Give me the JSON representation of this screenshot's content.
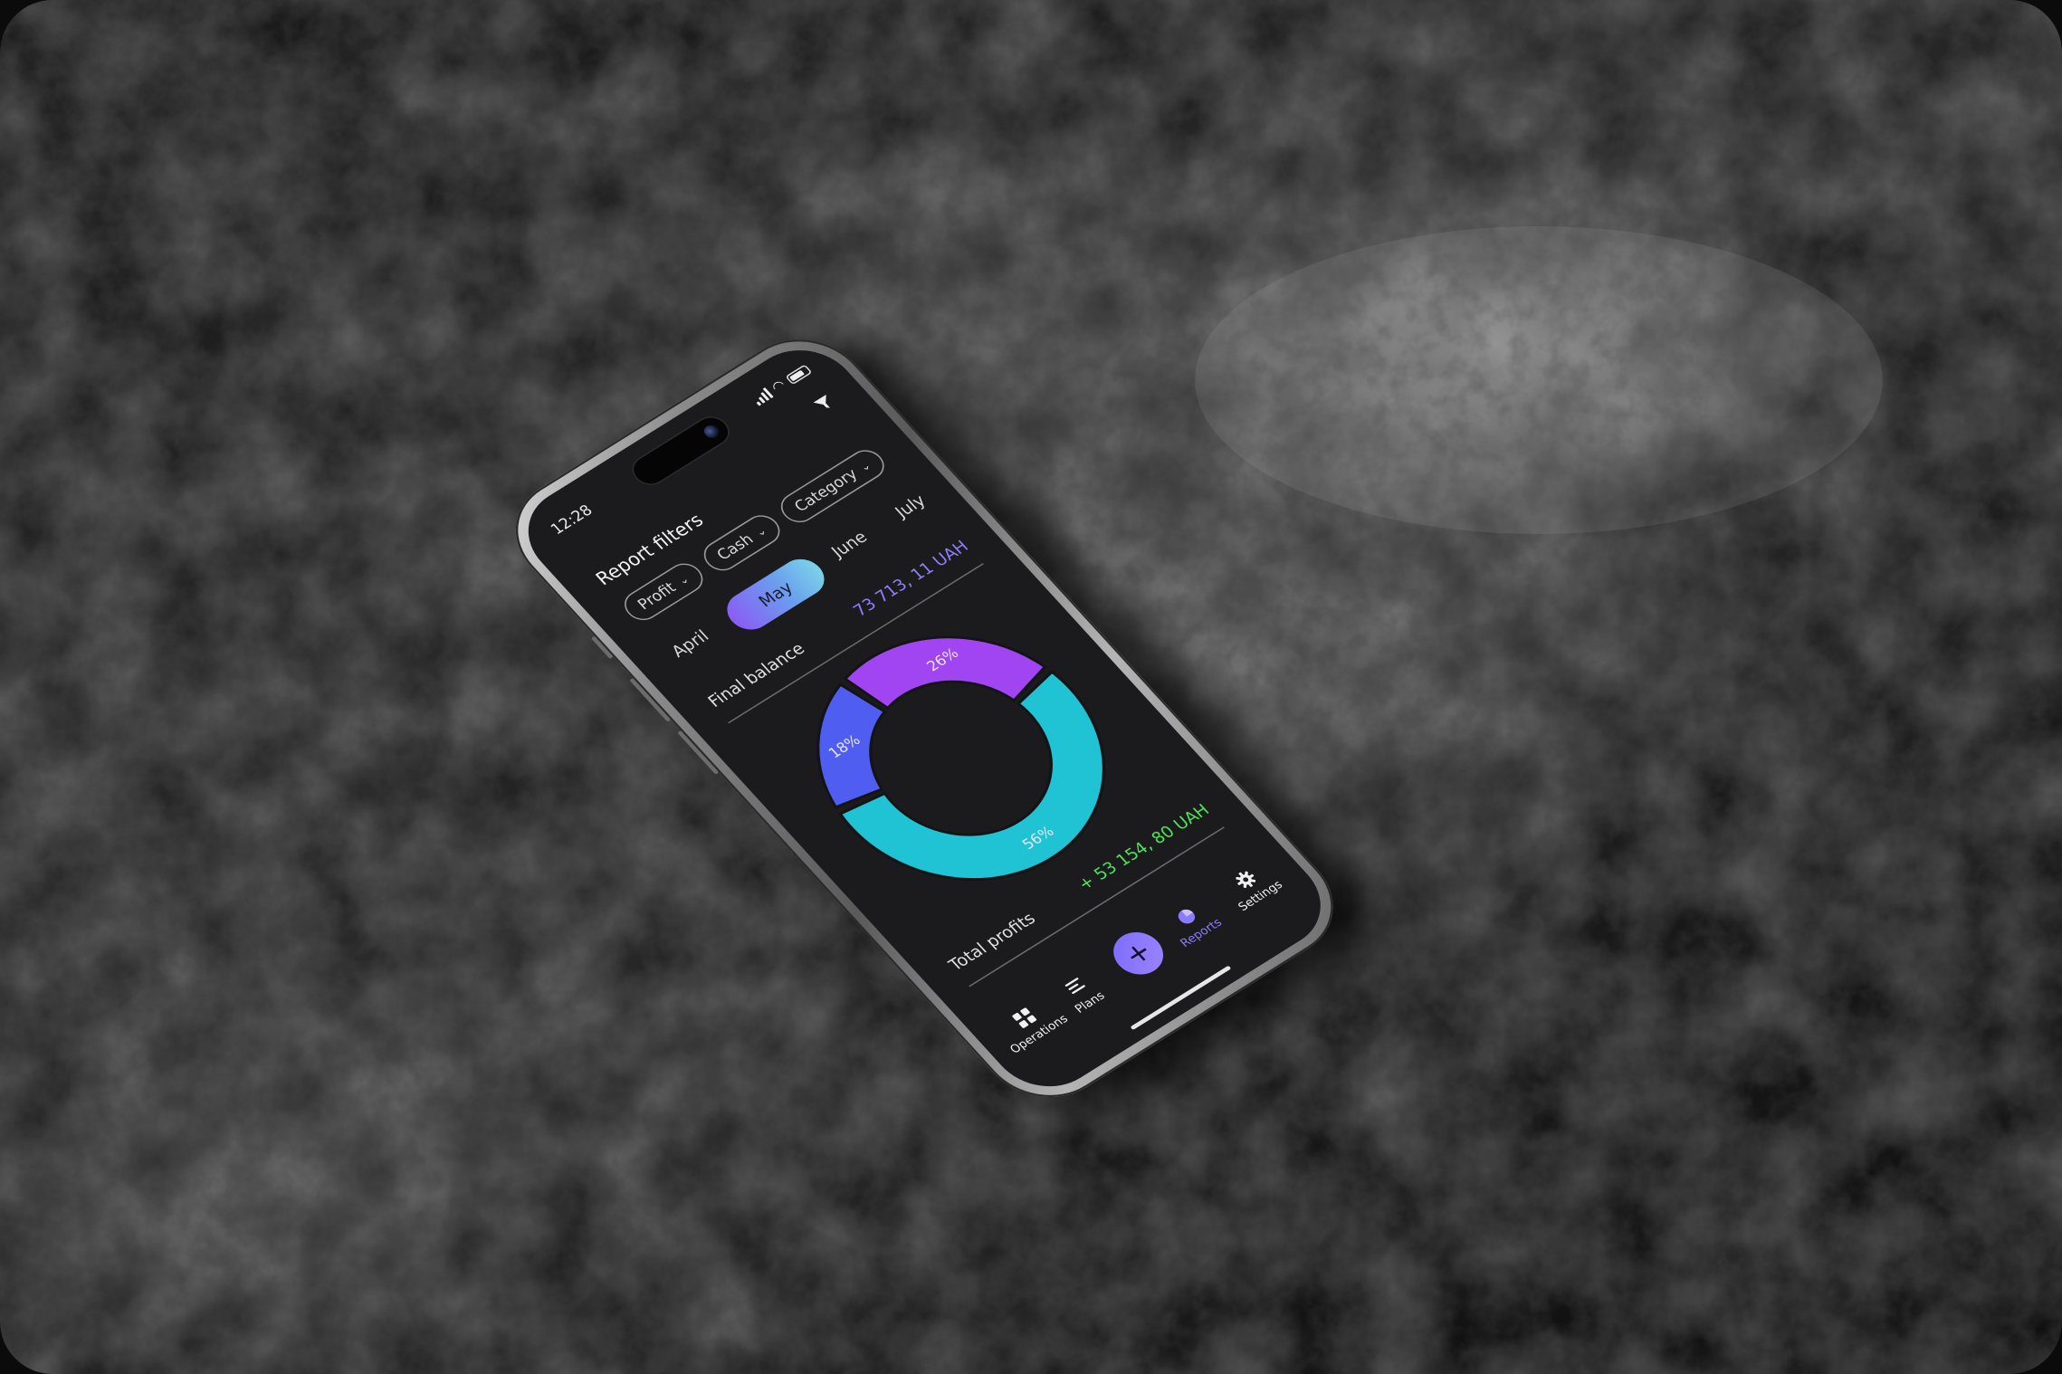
{
  "status_bar": {
    "time": "12:28"
  },
  "page": {
    "title": "Report filters"
  },
  "filters": [
    {
      "label": "Profit"
    },
    {
      "label": "Cash"
    },
    {
      "label": "Category"
    }
  ],
  "months": [
    {
      "label": "April",
      "active": false
    },
    {
      "label": "May",
      "active": true
    },
    {
      "label": "June",
      "active": false
    },
    {
      "label": "July",
      "active": false
    }
  ],
  "balance": {
    "label": "Final balance",
    "value": "73 713, 11 UAH"
  },
  "chart_data": {
    "type": "pie",
    "categories": [
      "",
      "",
      ""
    ],
    "values": [
      18,
      26,
      56
    ],
    "labels": [
      "18%",
      "26%",
      "56%"
    ],
    "colors": [
      "#4f5ef0",
      "#a144f2",
      "#1fc3d3"
    ],
    "donut": true
  },
  "profits": {
    "label": "Total profits",
    "value": "+ 53 154, 80 UAH"
  },
  "tabbar": {
    "items": [
      {
        "label": "Operations",
        "icon": "operations-icon",
        "active": false
      },
      {
        "label": "Plans",
        "icon": "plans-icon",
        "active": false
      },
      {
        "label": "Reports",
        "icon": "reports-icon",
        "active": true
      },
      {
        "label": "Settings",
        "icon": "gear-icon",
        "active": false
      }
    ],
    "add_symbol": "+"
  },
  "colors": {
    "accent": "#8a7cff",
    "positive": "#4ee35a",
    "balance": "#8f7dff",
    "screen_bg": "#1b1b1d"
  }
}
